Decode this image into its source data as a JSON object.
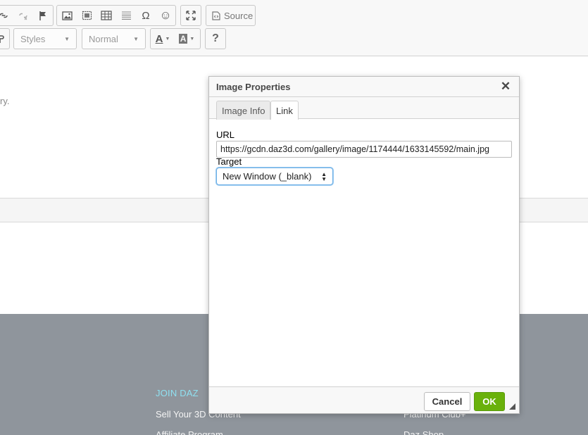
{
  "toolbar": {
    "source_label": "Source",
    "styles_combo": "Styles",
    "format_combo": "Normal",
    "help_label": "?",
    "text_color_label": "A",
    "bg_color_label": "A",
    "special_char_label": "Ω",
    "smiley_label": "☺"
  },
  "editor": {
    "truncated_text": "ry."
  },
  "footer": {
    "heading": "JOIN DAZ",
    "links": [
      "Sell Your 3D Content",
      "Affiliate Program",
      "Platinum Club+",
      "Daz Shop"
    ]
  },
  "dialog": {
    "title": "Image Properties",
    "close_label": "✕",
    "tabs": [
      {
        "label": "Image Info",
        "active": false
      },
      {
        "label": "Link",
        "active": true
      }
    ],
    "url_label": "URL",
    "url_value": "https://gcdn.daz3d.com/gallery/image/1174444/1633145592/main.jpg",
    "target_label": "Target",
    "target_value": "New Window (_blank)",
    "cancel_label": "Cancel",
    "ok_label": "OK"
  },
  "colors": {
    "ok_button": "#69b10b",
    "footer_bg": "#8f959c",
    "footer_heading": "#8fe0f0"
  }
}
